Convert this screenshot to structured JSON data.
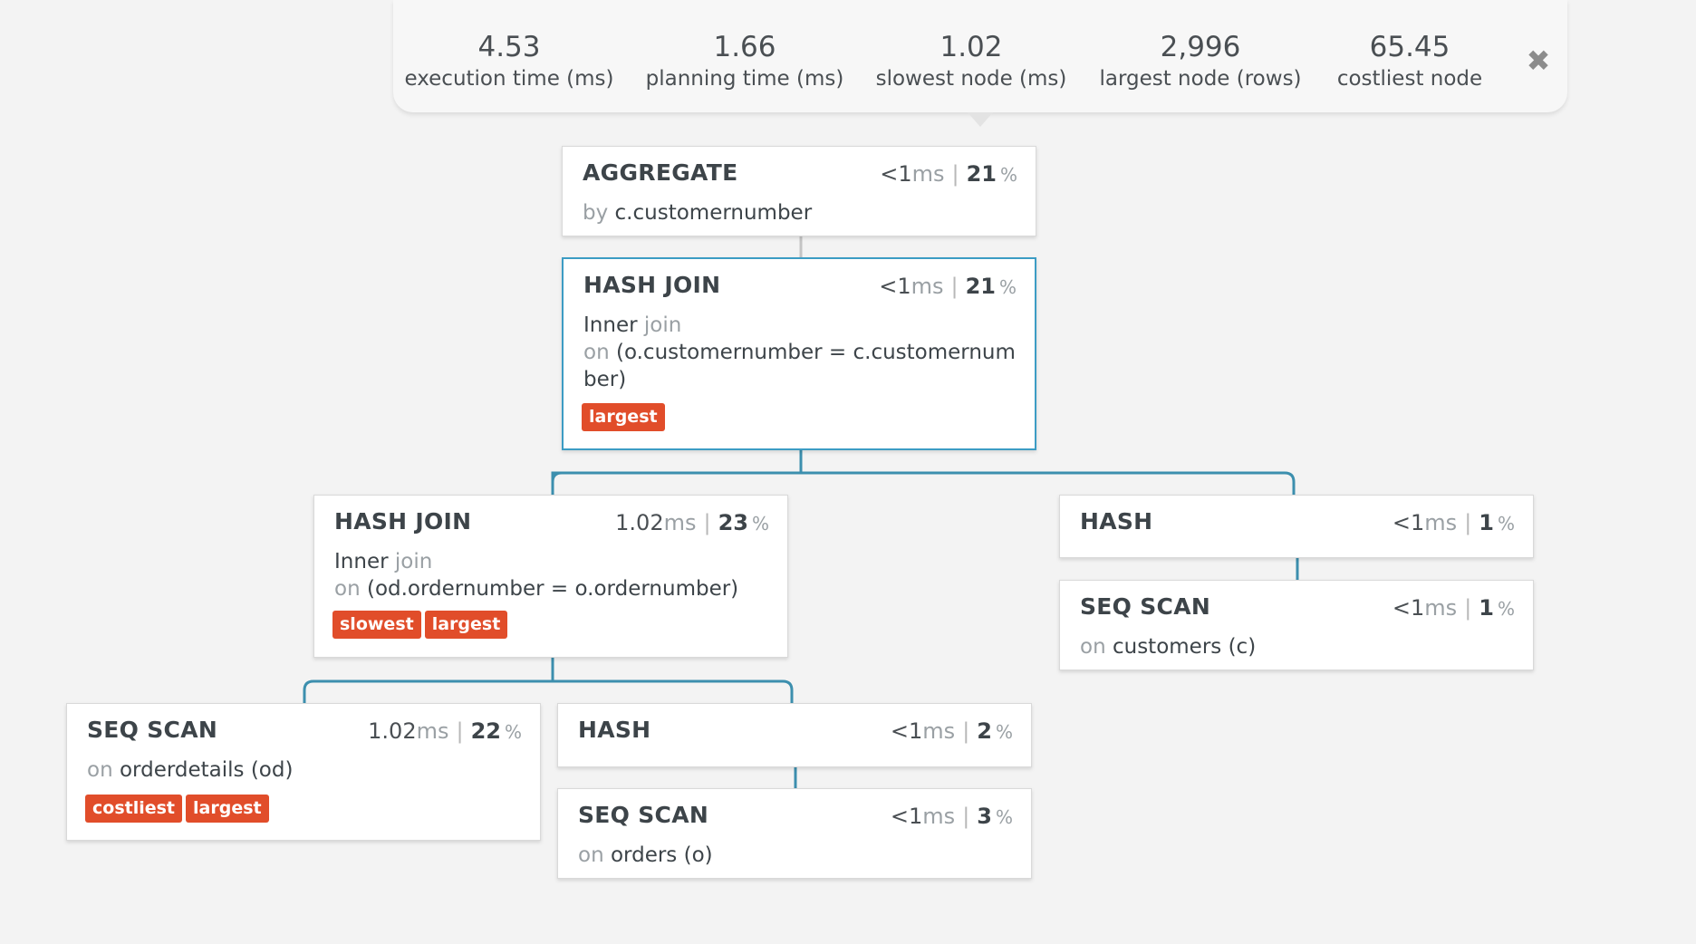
{
  "stats": [
    {
      "value": "4.53",
      "label": "execution time (ms)"
    },
    {
      "value": "1.66",
      "label": "planning time (ms)"
    },
    {
      "value": "1.02",
      "label": "slowest node (ms)"
    },
    {
      "value": "2,996",
      "label": "largest node (rows)"
    },
    {
      "value": "65.45",
      "label": "costliest node"
    }
  ],
  "close_icon": "✖",
  "colors": {
    "tag": "#e14d2a",
    "link": "#3c8fae",
    "link_top": "#c4c4c4",
    "selected_border": "#3c9cc4"
  },
  "nodes": {
    "aggregate": {
      "title": "AGGREGATE",
      "time": "<1",
      "unit": "ms",
      "pct": "21",
      "pct_sign": "%",
      "d1_muted": "by",
      "d1_text": "c.customernumber"
    },
    "hashjoin1": {
      "title": "HASH JOIN",
      "time": "<1",
      "unit": "ms",
      "pct": "21",
      "pct_sign": "%",
      "d1_text": "Inner",
      "d1_muted": "join",
      "d2_muted": "on",
      "d2_text": "(o.customernumber = c.customernumber)",
      "tags": [
        "largest"
      ]
    },
    "hashjoin2": {
      "title": "HASH JOIN",
      "time": "1.02",
      "unit": "ms",
      "pct": "23",
      "pct_sign": "%",
      "d1_text": "Inner",
      "d1_muted": "join",
      "d2_muted": "on",
      "d2_text": "(od.ordernumber = o.ordernumber)",
      "tags": [
        "slowest",
        "largest"
      ]
    },
    "hash_c": {
      "title": "HASH",
      "time": "<1",
      "unit": "ms",
      "pct": "1",
      "pct_sign": "%"
    },
    "seqscan_c": {
      "title": "SEQ SCAN",
      "time": "<1",
      "unit": "ms",
      "pct": "1",
      "pct_sign": "%",
      "d1_muted": "on",
      "d1_text": "customers (c)"
    },
    "seqscan_od": {
      "title": "SEQ SCAN",
      "time": "1.02",
      "unit": "ms",
      "pct": "22",
      "pct_sign": "%",
      "d1_muted": "on",
      "d1_text": "orderdetails (od)",
      "tags": [
        "costliest",
        "largest"
      ]
    },
    "hash_o": {
      "title": "HASH",
      "time": "<1",
      "unit": "ms",
      "pct": "2",
      "pct_sign": "%"
    },
    "seqscan_o": {
      "title": "SEQ SCAN",
      "time": "<1",
      "unit": "ms",
      "pct": "3",
      "pct_sign": "%",
      "d1_muted": "on",
      "d1_text": "orders (o)"
    }
  }
}
